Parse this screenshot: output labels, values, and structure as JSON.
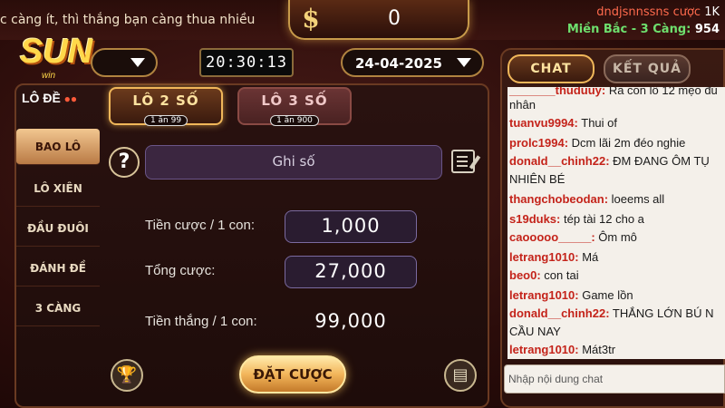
{
  "marquee": "c càng ít, thì thắng bạn càng thua nhiều",
  "balance": {
    "currency_icon": "$",
    "value": "0"
  },
  "user": {
    "name_prefix": "dndjsnnssns cược",
    "bet_amount": "1K",
    "region": "Miền Bắc - 3 Càng:",
    "count": "954"
  },
  "logo": {
    "brand": "SUN",
    "sub": "win"
  },
  "region_select": {
    "value": "",
    "arrow_icon": "chevron-down-icon"
  },
  "clock": "20:30:13",
  "date_select": {
    "value": "24-04-2025",
    "arrow_icon": "chevron-down-icon"
  },
  "lode_label": "LÔ ĐỀ",
  "lode_balls": "●●",
  "game_tabs": [
    {
      "label": "LÔ 2 SỐ",
      "rate": "1 ăn 99",
      "active": true
    },
    {
      "label": "LÔ 3 SỐ",
      "rate": "1 ăn 900",
      "active": false
    }
  ],
  "sidebar": [
    {
      "label": "BAO LÔ",
      "active": true
    },
    {
      "label": "LÔ XIÊN",
      "active": false
    },
    {
      "label": "ĐẦU ĐUÔI",
      "active": false
    },
    {
      "label": "ĐÁNH ĐỀ",
      "active": false
    },
    {
      "label": "3 CÀNG",
      "active": false
    }
  ],
  "help_icon": "?",
  "number_input": {
    "placeholder": "Ghi số"
  },
  "rows": [
    {
      "label": "Tiền cược / 1 con:",
      "value": "1,000"
    },
    {
      "label": "Tổng cược:",
      "value": "27,000"
    },
    {
      "label": "Tiền thắng / 1 con:",
      "value": "99,000"
    }
  ],
  "bet_button": "ĐẶT CƯỢC",
  "trophy_icon": "🏆",
  "history_icon": "▤",
  "chat_tabs": [
    {
      "label": "CHAT",
      "active": true
    },
    {
      "label": "KẾT QUẢ",
      "active": false
    }
  ],
  "chat_messages": [
    {
      "user": "_______thuduuy:",
      "text": " Ra con lô 12 mẹo đủ"
    },
    {
      "user": "",
      "text": "nhân"
    },
    {
      "user": "tuanvu9994:",
      "text": " Thui of"
    },
    {
      "user": "prolc1994:",
      "text": " Dcm lãi 2m đéo nghie"
    },
    {
      "user": "donald__chinh22:",
      "text": " ĐM ĐANG ÔM TỤ"
    },
    {
      "user": "",
      "text": "NHIÊN BÉ"
    },
    {
      "user": "thangchobeodan:",
      "text": " loeems all"
    },
    {
      "user": "s19duks:",
      "text": " tép tài 12 cho a"
    },
    {
      "user": "caooooo_____:",
      "text": " Ôm mô"
    },
    {
      "user": "letrang1010:",
      "text": " Má"
    },
    {
      "user": "beo0:",
      "text": "  con tai"
    },
    {
      "user": "letrang1010:",
      "text": " Game lồn"
    },
    {
      "user": "donald__chinh22:",
      "text": " THẮNG LỚN BÚ N"
    },
    {
      "user": "",
      "text": "CẦU NAY"
    },
    {
      "user": "letrang1010:",
      "text": " Mát3tr"
    }
  ],
  "chat_input": {
    "placeholder": "Nhập nội dung chat"
  }
}
